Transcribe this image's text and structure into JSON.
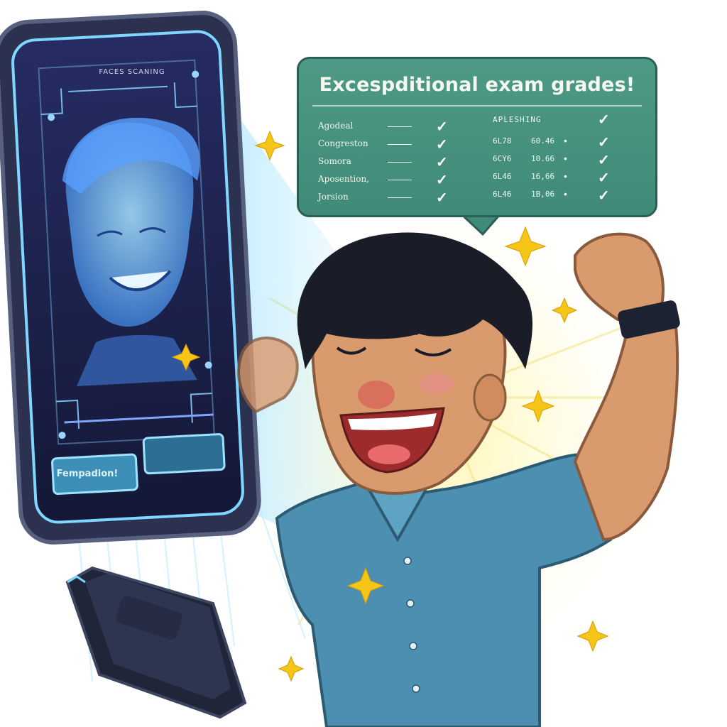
{
  "bubble": {
    "title": "Excespditional exam grades!",
    "right_header": "APLESHING",
    "left_rows": [
      {
        "label": "Agodeal"
      },
      {
        "label": "Congreston"
      },
      {
        "label": "Somora"
      },
      {
        "label": "Aposention,"
      },
      {
        "label": "Jorsion"
      }
    ],
    "right_rows": [
      {
        "v1": "6L78",
        "v2": "60.46"
      },
      {
        "v1": "6CY6",
        "v2": "10.66"
      },
      {
        "v1": "6L46",
        "v2": "16,66"
      },
      {
        "v1": "6L46",
        "v2": "1B,06"
      }
    ]
  },
  "screen": {
    "caption": "FACES SCANING",
    "button_label": "Fempadion!"
  },
  "colors": {
    "bubble_green": "#4f9a86",
    "screen_dark": "#1d2350",
    "hologram_blue": "#6ec8ff",
    "shirt_blue": "#4c8fb0",
    "skin": "#d99a6e",
    "hair": "#1a1c28",
    "sparkle_yellow": "#f5c518"
  }
}
